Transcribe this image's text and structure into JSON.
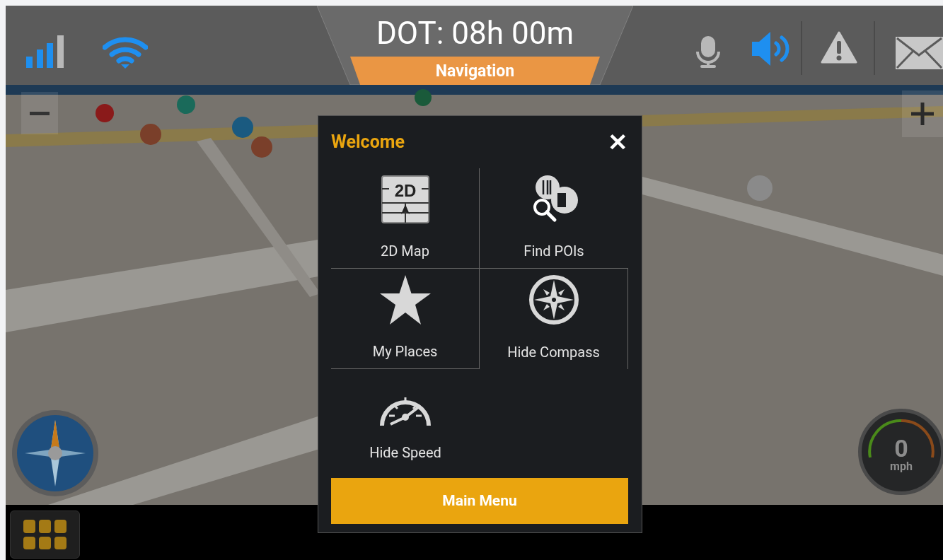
{
  "status_bar": {
    "timer": "DOT: 08h 00m",
    "mode": "Navigation"
  },
  "speedometer": {
    "value": "0",
    "unit": "mph"
  },
  "dialog": {
    "title": "Welcome",
    "close": "✕",
    "items": [
      {
        "label": "2D Map",
        "icon_text": "2D"
      },
      {
        "label": "Find POIs"
      },
      {
        "label": "My Places"
      },
      {
        "label": "Hide Compass"
      },
      {
        "label": "Hide Speed"
      }
    ],
    "button": "Main Menu"
  }
}
